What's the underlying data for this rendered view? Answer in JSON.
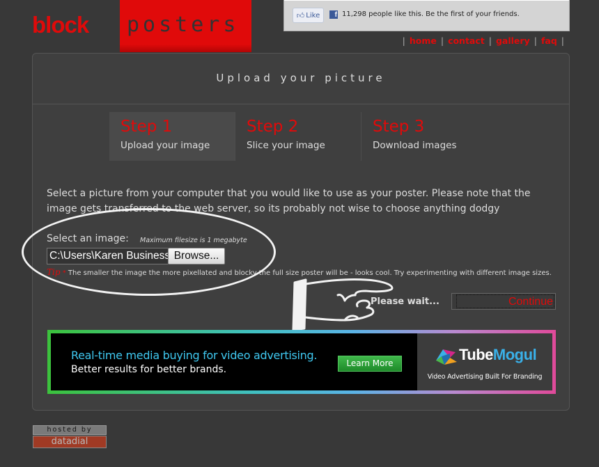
{
  "logo": {
    "word1": "block",
    "word2": "posters",
    "brand_color": "#e00a0a"
  },
  "facebook": {
    "like_label": "Like",
    "like_icon": "thumbs-up-icon",
    "fb_icon": "facebook-icon",
    "fb_letter": "f",
    "text": "11,298 people like this. Be the first of your friends."
  },
  "nav": {
    "items": [
      {
        "label": "home"
      },
      {
        "label": "contact"
      },
      {
        "label": "gallery"
      },
      {
        "label": "faq"
      }
    ],
    "separator": "|"
  },
  "main": {
    "title": "Upload your picture",
    "steps": [
      {
        "number": "Step 1",
        "label": "Upload your image",
        "active": true
      },
      {
        "number": "Step 2",
        "label": "Slice your image",
        "active": false
      },
      {
        "number": "Step 3",
        "label": "Download images",
        "active": false
      }
    ],
    "intro": "Select a picture from your computer that you would like to use as your poster. Please note that the image gets transferred to the web server, so its probably not wise to choose anything dodgy",
    "upload": {
      "label": "Select an image:",
      "max_note": "Maximum filesize is 1 megabyte",
      "file_value": "C:\\Users\\Karen Business",
      "browse_label": "Browse..."
    },
    "tip": {
      "label": "Tip",
      "star": "*",
      "text": "The smaller the image the more pixellated and blocky the full size poster will be - looks cool. Try experimenting with different image sizes."
    },
    "status": "Please wait...",
    "continue_label": "Continue"
  },
  "ad": {
    "headline": "Real-time media buying for video advertising.",
    "subline": "Better results for better brands.",
    "cta": "Learn More",
    "brand_part1": "Tube",
    "brand_part2": "Mogul",
    "tagline": "Video Advertising Built For Branding"
  },
  "footer": {
    "hosted_by": "hosted by",
    "host_name": "datadial"
  }
}
